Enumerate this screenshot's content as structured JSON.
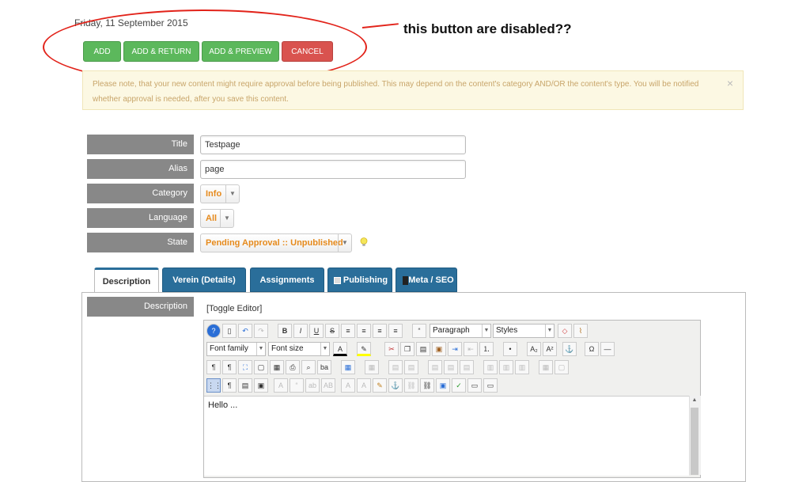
{
  "header": {
    "date": "Friday, 11 September 2015"
  },
  "toolbar": {
    "add": "ADD",
    "add_return": "ADD & RETURN",
    "add_preview": "ADD & PREVIEW",
    "cancel": "CANCEL"
  },
  "annotation": {
    "text": "this button are disabled??"
  },
  "notice": {
    "text": "Please note, that your new content might require approval before being published. This may depend on the content's category AND/OR the content's type. You will be notified whether approval is needed, after you save this content.",
    "close": "×"
  },
  "form": {
    "title_label": "Title",
    "title_value": "Testpage",
    "alias_label": "Alias",
    "alias_value": "page",
    "category_label": "Category",
    "category_value": "Info",
    "language_label": "Language",
    "language_value": "All",
    "state_label": "State",
    "state_value": "Pending Approval :: Unpublished"
  },
  "tabs": [
    {
      "label": "Description"
    },
    {
      "label": "Verein (Details)"
    },
    {
      "label": "Assignments"
    },
    {
      "label": "Publishing"
    },
    {
      "label": "Meta / SEO"
    }
  ],
  "description": {
    "label": "Description",
    "toggle": "[Toggle Editor]",
    "content": "Hello ..."
  },
  "editor": {
    "paragraph": "Paragraph",
    "styles": "Styles",
    "font_family": "Font family",
    "font_size": "Font size"
  },
  "colors": {
    "green": "#5cb85c",
    "red": "#d9534f",
    "tab_blue": "#2a6e9a",
    "label_gray": "#888888",
    "accent_orange": "#e68a1c"
  }
}
